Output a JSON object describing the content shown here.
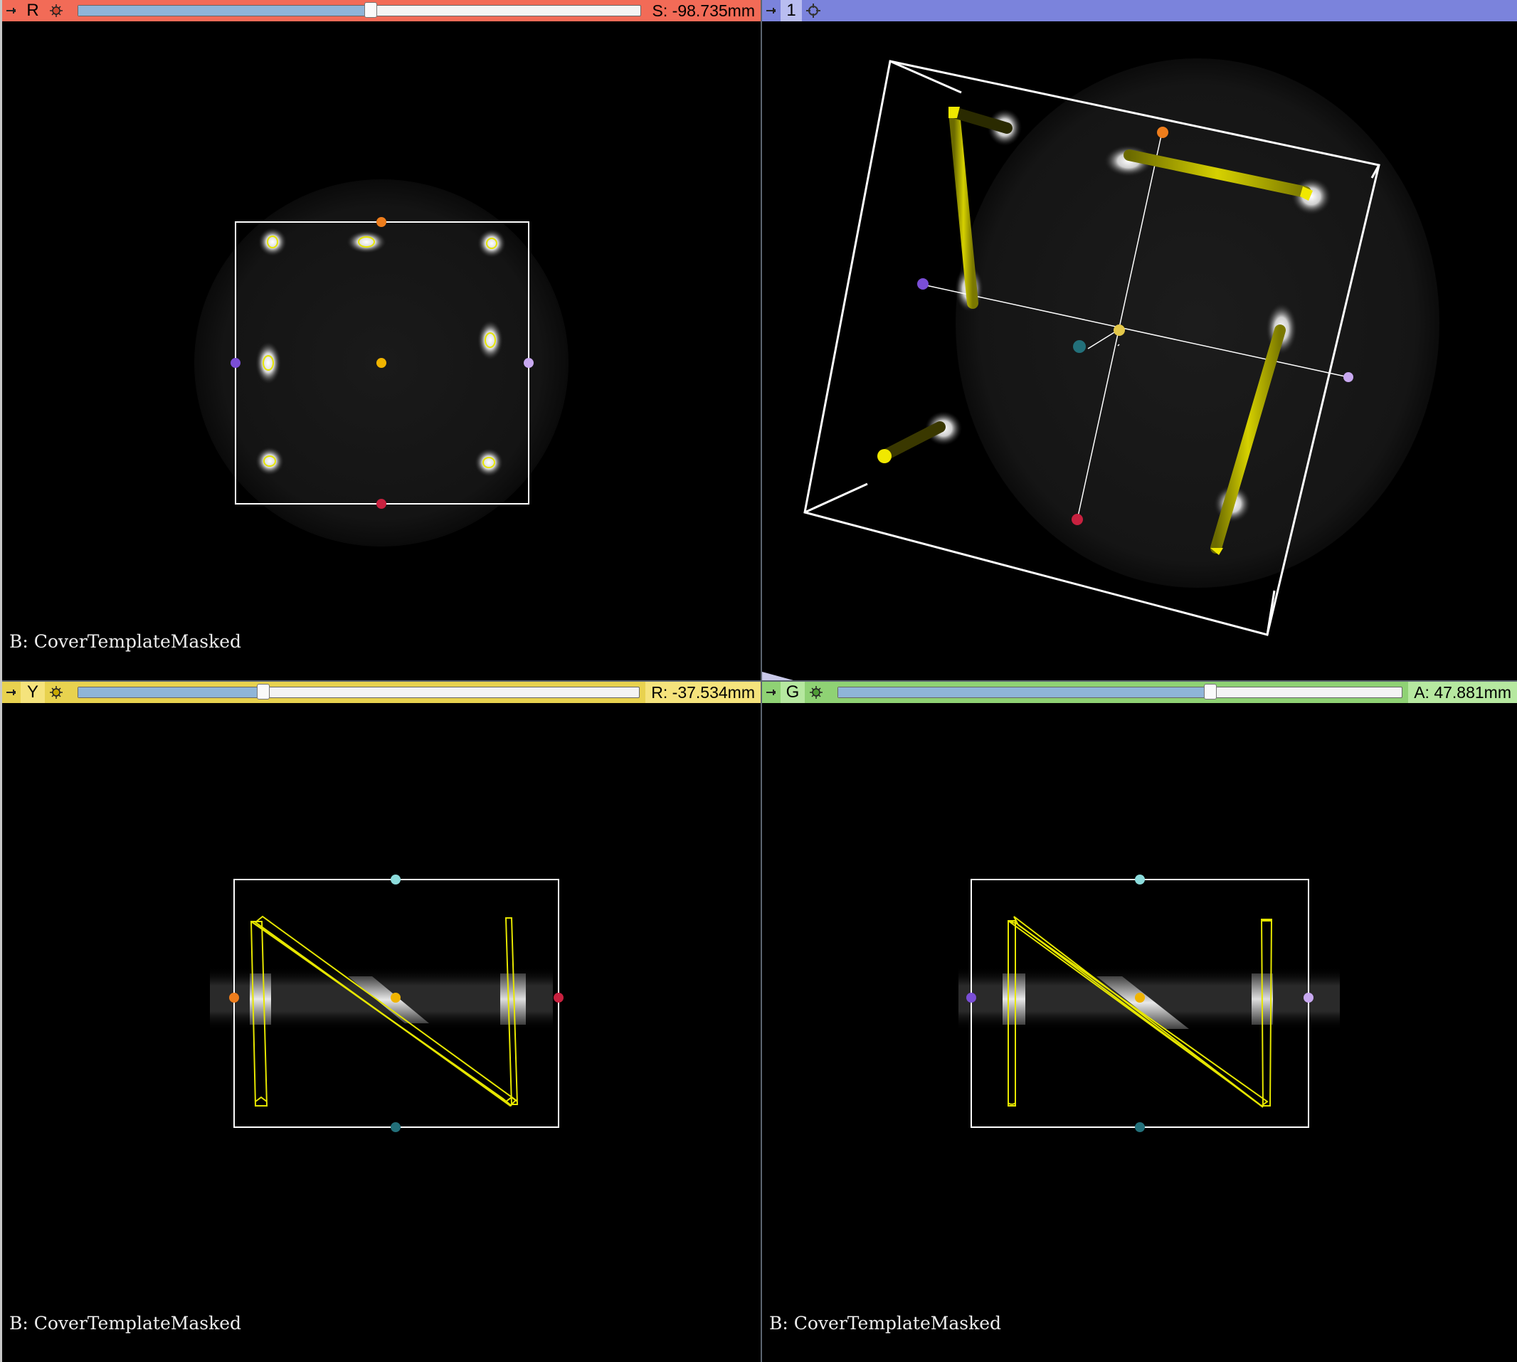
{
  "views": {
    "red": {
      "letter": "R",
      "readout": "S: -98.735mm",
      "slider_fraction": 0.52,
      "bar_color": "#f26b57",
      "letter_bg": "#f26b57",
      "readout_bg": "#f26b57",
      "label": "B: CoverTemplateMasked"
    },
    "three_d": {
      "letter": "1",
      "bar_color": "#7b83dc",
      "letter_bg": "#b9bdf0"
    },
    "yellow": {
      "letter": "Y",
      "readout": "R: -37.534mm",
      "slider_fraction": 0.33,
      "bar_color": "#e8d24f",
      "letter_bg": "#f5e37c",
      "readout_bg": "#f5e37c",
      "label": "B: CoverTemplateMasked"
    },
    "green": {
      "letter": "G",
      "readout": "A: 47.881mm",
      "slider_fraction": 0.66,
      "bar_color": "#8fd274",
      "letter_bg": "#b6e8a0",
      "readout_bg": "#b6e8a0",
      "label": "B: CoverTemplateMasked"
    }
  },
  "icons": {
    "pin": "pin-icon",
    "slice_options": "slice-options-icon",
    "view_options": "crosshair-icon"
  },
  "colors": {
    "fiducial_line": "#e6e600",
    "roi_box": "#ffffff",
    "handle_orange": "#ee7d1c",
    "handle_purple": "#7a4ed6",
    "handle_lilac": "#c8a8f0",
    "handle_red": "#c8213f",
    "handle_center": "#f0b400",
    "handle_cyan": "#8cdcdc",
    "handle_teal": "#23707a"
  }
}
